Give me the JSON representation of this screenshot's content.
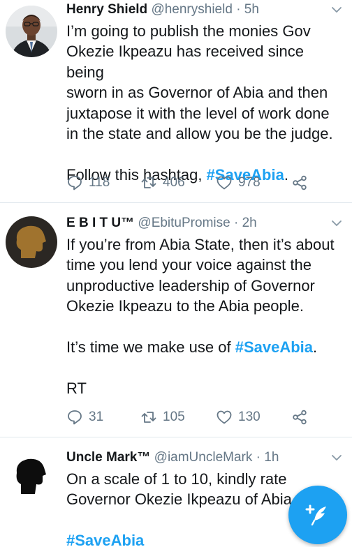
{
  "tweets": [
    {
      "name": "Henry Shield",
      "handle": "@henryshield",
      "separator": "·",
      "time": "5h",
      "lines": [
        "I’m going to publish the monies Gov",
        "Okezie Ikpeazu has received since being",
        "sworn in as Governor of Abia and then",
        "juxtapose it with the level of work done",
        "in the state and allow you be the judge."
      ],
      "follow_prefix": "Follow this hashtag, ",
      "follow_hashtag": "#SaveAbia",
      "follow_suffix": ".",
      "replies": "118",
      "retweets": "406",
      "likes": "978"
    },
    {
      "name": "E B I T U™",
      "handle": "@EbituPromise",
      "separator": "·",
      "time": "2h",
      "lines": [
        "If you’re from Abia State, then it’s about",
        "time you lend your voice against the",
        "unproductive leadership of Governor",
        "Okezie Ikpeazu to the Abia people."
      ],
      "time_prefix": "It’s time we make use of ",
      "time_hashtag": "#SaveAbia",
      "time_suffix": ".",
      "rt": "RT",
      "replies": "31",
      "retweets": "105",
      "likes": "130"
    },
    {
      "name": "Uncle Mark™",
      "handle": "@iamUncleMark",
      "separator": "·",
      "time": "1h",
      "lines": [
        "On a scale of 1 to 10, kindly rate",
        "Governor Okezie Ikpeazu of Abia"
      ],
      "hashtag": "#SaveAbia"
    }
  ],
  "colors": {
    "accent": "#1da1f2",
    "text": "#14171a",
    "muted": "#657786",
    "divider": "#e1e8ed"
  },
  "icons": [
    "reply-icon",
    "retweet-icon",
    "like-icon",
    "share-icon",
    "chevron-down-icon",
    "compose-icon"
  ]
}
